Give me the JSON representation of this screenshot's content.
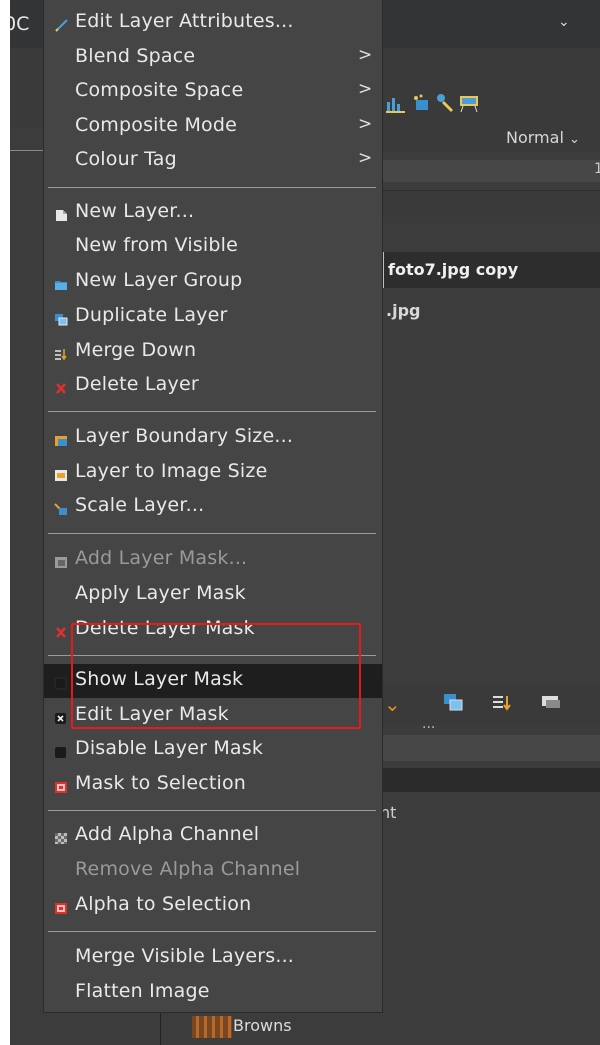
{
  "background_app": {
    "title_fragment": "00C",
    "mode_value": "Normal",
    "opacity_fragment": "1",
    "layers": [
      "foto7.jpg copy",
      ".jpg"
    ],
    "partial_text": "nt",
    "dots": "...",
    "palette_label": "Browns"
  },
  "menu": {
    "items": [
      {
        "label": "Edit Layer Attributes...",
        "icon": "pencil-icon"
      },
      {
        "label": "Blend Space",
        "submenu": true
      },
      {
        "label": "Composite Space",
        "submenu": true
      },
      {
        "label": "Composite Mode",
        "submenu": true
      },
      {
        "label": "Colour Tag",
        "submenu": true
      },
      {
        "label": "New Layer...",
        "icon": "new-layer-icon"
      },
      {
        "label": "New from Visible"
      },
      {
        "label": "New Layer Group",
        "icon": "folder-icon"
      },
      {
        "label": "Duplicate Layer",
        "icon": "duplicate-icon"
      },
      {
        "label": "Merge Down",
        "icon": "merge-down-icon"
      },
      {
        "label": "Delete Layer",
        "icon": "delete-icon"
      },
      {
        "label": "Layer Boundary Size...",
        "icon": "boundary-icon"
      },
      {
        "label": "Layer to Image Size",
        "icon": "to-image-size-icon"
      },
      {
        "label": "Scale Layer...",
        "icon": "scale-icon"
      },
      {
        "label": "Add Layer Mask...",
        "icon": "add-mask-icon",
        "disabled": true
      },
      {
        "label": "Apply Layer Mask"
      },
      {
        "label": "Delete Layer Mask",
        "icon": "delete-mask-icon"
      },
      {
        "label": "Show Layer Mask",
        "icon": "checkbox-icon",
        "highlighted": true
      },
      {
        "label": "Edit Layer Mask",
        "icon": "checkbox-checked-icon"
      },
      {
        "label": "Disable Layer Mask",
        "icon": "checkbox-icon"
      },
      {
        "label": "Mask to Selection",
        "icon": "mask-selection-icon"
      },
      {
        "label": "Add Alpha Channel",
        "icon": "checker-icon"
      },
      {
        "label": "Remove Alpha Channel",
        "disabled": true
      },
      {
        "label": "Alpha to Selection",
        "icon": "alpha-selection-icon"
      },
      {
        "label": "Merge Visible Layers..."
      },
      {
        "label": "Flatten Image"
      }
    ],
    "submenu_arrow": ">"
  },
  "colors": {
    "menu_bg": "#454545",
    "highlight_bg": "#1e1e1e",
    "annotation_red": "#e21b1b"
  }
}
